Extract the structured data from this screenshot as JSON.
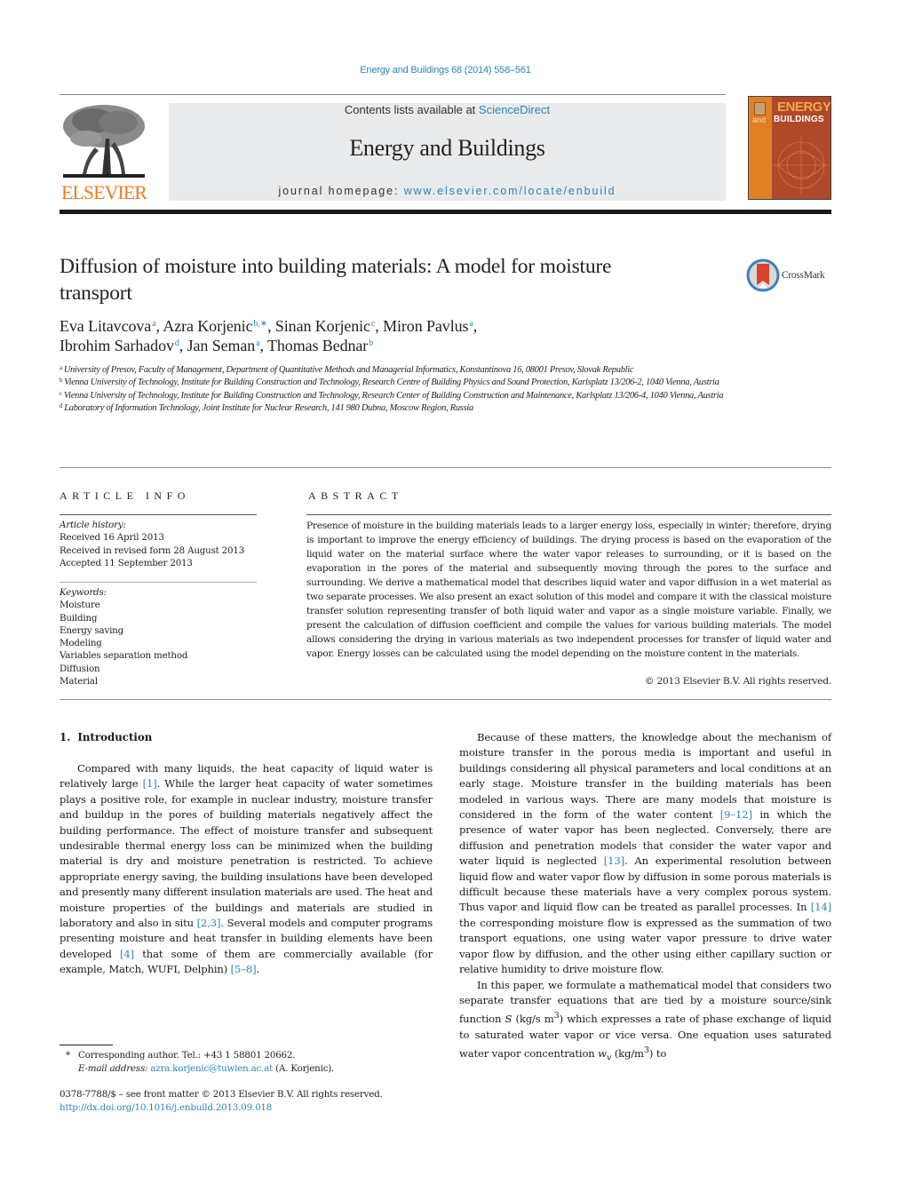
{
  "header": {
    "journal_ref": "Energy and Buildings 68 (2014) 558–561",
    "contents_prefix": "Contents lists available at ",
    "contents_link": "ScienceDirect",
    "journal_name": "Energy and Buildings",
    "homepage_prefix": "journal homepage: ",
    "homepage_link": "www.elsevier.com/locate/enbuild",
    "publisher_logo_text": "ELSEVIER",
    "cover": {
      "title_top": "ENERGY",
      "title_and": "and",
      "title_bottom": "BUILDINGS"
    },
    "colors": {
      "link": "#2a86b9",
      "elsevier_orange": "#f07c1e",
      "banner_grey": "#e9eaeb"
    }
  },
  "article": {
    "title": "Diffusion of moisture into building materials: A model for moisture transport",
    "crossmark_label": "CrossMark",
    "authors": [
      {
        "name": "Eva Litavcova",
        "sup": "a",
        "sep": ", "
      },
      {
        "name": "Azra Korjenic",
        "sup": "b,∗",
        "sep": ", "
      },
      {
        "name": "Sinan Korjenic",
        "sup": "c",
        "sep": ", "
      },
      {
        "name": "Miron Pavlus",
        "sup": "a",
        "sep": ","
      },
      {
        "name": "Ibrohim Sarhadov",
        "sup": "d",
        "sep": ", "
      },
      {
        "name": "Jan Seman",
        "sup": "a",
        "sep": ", "
      },
      {
        "name": "Thomas Bednar",
        "sup": "b",
        "sep": ""
      }
    ],
    "affiliations": [
      {
        "key": "a",
        "text": "University of Presov, Faculty of Management, Department of Quantitative Methods and Managerial Informatics, Konstantinova 16, 08001 Presov, Slovak Republic"
      },
      {
        "key": "b",
        "text": "Vienna University of Technology, Institute for Building Construction and Technology, Research Centre of Building Physics and Sound Protection, Karlsplatz 13/206-2, 1040 Vienna, Austria"
      },
      {
        "key": "c",
        "text": "Vienna University of Technology, Institute for Building Construction and Technology, Research Center of Building Construction and Maintenance, Karlsplatz 13/206-4, 1040 Vienna, Austria"
      },
      {
        "key": "d",
        "text": "Laboratory of Information Technology, Joint Institute for Nuclear Research, 141 980 Dubna, Moscow Region, Russia"
      }
    ]
  },
  "article_info": {
    "heading": "ARTICLE INFO",
    "history_label": "Article history:",
    "history": [
      "Received 16 April 2013",
      "Received in revised form 28 August 2013",
      "Accepted 11 September 2013"
    ],
    "keywords_label": "Keywords:",
    "keywords": [
      "Moisture",
      "Building",
      "Energy saving",
      "Modeling",
      "Variables separation method",
      "Diffusion",
      "Material"
    ]
  },
  "abstract": {
    "heading": "ABSTRACT",
    "text": "Presence of moisture in the building materials leads to a larger energy loss, especially in winter; therefore, drying is important to improve the energy efficiency of buildings. The drying process is based on the evaporation of the liquid water on the material surface where the water vapor releases to surrounding, or it is based on the evaporation in the pores of the material and subsequently moving through the pores to the surface and surrounding. We derive a mathematical model that describes liquid water and vapor diffusion in a wet material as two separate processes. We also present an exact solution of this model and compare it with the classical moisture transfer solution representing transfer of both liquid water and vapor as a single moisture variable. Finally, we present the calculation of diffusion coefficient and compile the values for various building materials. The model allows considering the drying in various materials as two independent processes for transfer of liquid water and vapor. Energy losses can be calculated using the model depending on the moisture content in the materials.",
    "copyright": "© 2013 Elsevier B.V. All rights reserved."
  },
  "introduction": {
    "number": "1.",
    "heading": "Introduction",
    "p1": {
      "t1": "Compared with many liquids, the heat capacity of liquid water is relatively large ",
      "r1": "[1]",
      "t2": ". While the larger heat capacity of water sometimes plays a positive role, for example in nuclear industry, moisture transfer and buildup in the pores of building materials negatively affect the building performance. The effect of moisture transfer and subsequent undesirable thermal energy loss can be minimized when the building material is dry and moisture penetration is restricted. To achieve appropriate energy saving, the building insulations have been developed and presently many different insulation materials are used. The heat and moisture properties of the buildings and materials are studied in laboratory and also in situ ",
      "r2": "[2,3]",
      "t3": ". Several models and computer programs presenting moisture and heat transfer in building elements have been developed ",
      "r3": "[4]",
      "t4": " that some of them are commercially available (for example, Match, WUFI, Delphin) ",
      "r4": "[5–8]",
      "t5": "."
    },
    "p2": {
      "t1": "Because of these matters, the knowledge about the mechanism of moisture transfer in the porous media is important and useful in buildings considering all physical parameters and local conditions at an early stage. Moisture transfer in the building materials has been modeled in various ways. There are many models that moisture is considered in the form of the water content ",
      "r1": "[9–12]",
      "t2": " in which the presence of water vapor has been neglected. Conversely, there are diffusion and penetration models that consider the water vapor and water liquid is neglected ",
      "r2": "[13]",
      "t3": ". An experimental resolution between liquid flow and water vapor flow by diffusion in some porous materials is difficult because these materials have a very complex porous system. Thus vapor and liquid flow can be treated as parallel processes. In ",
      "r3": "[14]",
      "t4": " the corresponding moisture flow is expressed as the summation of two transport equations, one using water vapor pressure to drive water vapor flow by diffusion, and the other using either capillary suction or relative humidity to drive moisture flow."
    },
    "p3": {
      "t1": "In this paper, we formulate a mathematical model that considers two separate transfer equations that are tied by a moisture source/sink function ",
      "s_var": "S",
      "t2": " (kg/s m",
      "sup1": "3",
      "t3": ") which expresses a rate of phase exchange of liquid to saturated water vapor or vice versa. One equation uses saturated water vapor concentration ",
      "w_var": "w",
      "w_sub": "v",
      "t4": " (kg/m",
      "sup2": "3",
      "t5": ") to"
    }
  },
  "footnote": {
    "star": "*",
    "corresponding": "Corresponding author. Tel.: +43 1 58801 20662.",
    "email_label": "E-mail address:",
    "email": "azra.korjenic@tuwien.ac.at",
    "email_suffix": " (A. Korjenic)."
  },
  "front_matter": {
    "issn_line": "0378-7788/$ – see front matter © 2013 Elsevier B.V. All rights reserved.",
    "doi": "http://dx.doi.org/10.1016/j.enbuild.2013.09.018"
  }
}
